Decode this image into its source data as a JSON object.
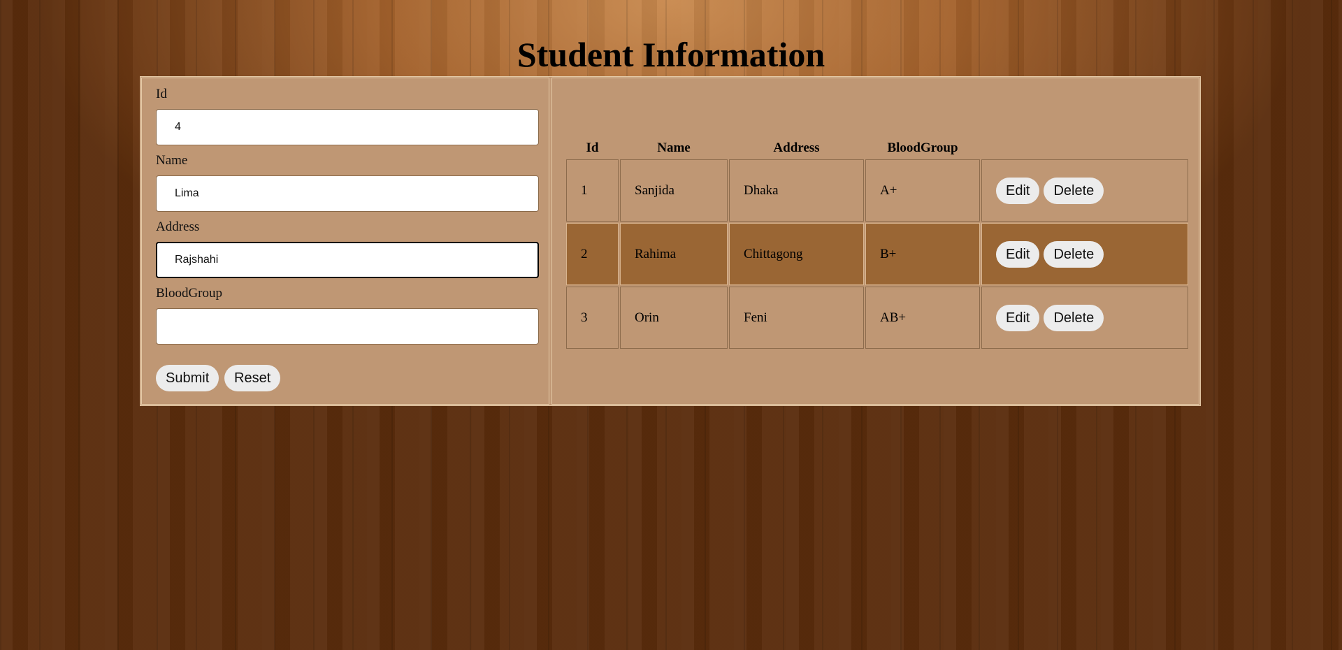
{
  "page": {
    "title": "Student Information"
  },
  "form": {
    "fields": [
      {
        "label": "Id",
        "value": "4",
        "placeholder": ""
      },
      {
        "label": "Name",
        "value": "Lima",
        "placeholder": ""
      },
      {
        "label": "Address",
        "value": "Rajshahi",
        "placeholder": ""
      },
      {
        "label": "BloodGroup",
        "value": "",
        "placeholder": ""
      }
    ],
    "submit_label": "Submit",
    "reset_label": "Reset"
  },
  "table": {
    "headers": [
      "Id",
      "Name",
      "Address",
      "BloodGroup",
      ""
    ],
    "rows": [
      {
        "id": "1",
        "name": "Sanjida",
        "address": "Dhaka",
        "blood": "A+"
      },
      {
        "id": "2",
        "name": "Rahima",
        "address": "Chittagong",
        "blood": "B+"
      },
      {
        "id": "3",
        "name": "Orin",
        "address": "Feni",
        "blood": "AB+"
      }
    ],
    "edit_label": "Edit",
    "delete_label": "Delete"
  },
  "colors": {
    "panel_bg": "#bf9774",
    "highlight_row": "#9a6634",
    "button_bg": "#ececec"
  }
}
